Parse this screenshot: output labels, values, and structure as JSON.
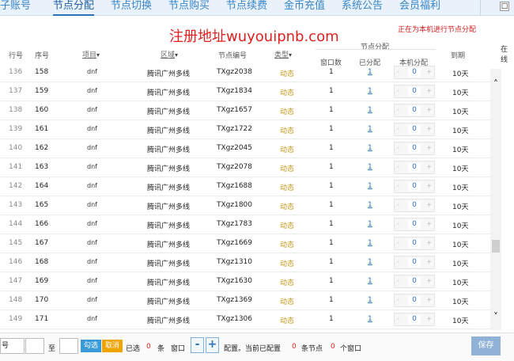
{
  "nav": {
    "tabs": [
      {
        "label": "子账号"
      },
      {
        "label": "节点分配"
      },
      {
        "label": "节点切换"
      },
      {
        "label": "节点购买"
      },
      {
        "label": "节点续费"
      },
      {
        "label": "金币充值"
      },
      {
        "label": "系统公告"
      },
      {
        "label": "会员福利"
      }
    ],
    "win_btn": "□"
  },
  "banner": {
    "watermark": "注册地址wuyouipnb.com",
    "status": "正在为本机进行节点分配",
    "right_cut": "在线"
  },
  "columns": {
    "rownum": "行号",
    "seq": "序号",
    "project": "项目",
    "area": "区域",
    "node_code": "节点编号",
    "type": "类型",
    "alloc_group": "节点分配",
    "win_count": "窗口数",
    "allocated": "已分配",
    "local_alloc": "本机分配",
    "expiry": "到期"
  },
  "rows": [
    {
      "rownum": "136",
      "seq": "158",
      "project": "dnf",
      "area": "腾讯广州多线",
      "code": "TXgz2038",
      "type": "动态",
      "win": "1",
      "alloc": "1",
      "local": "0",
      "exp": "10天"
    },
    {
      "rownum": "137",
      "seq": "159",
      "project": "dnf",
      "area": "腾讯广州多线",
      "code": "TXgz1834",
      "type": "动态",
      "win": "1",
      "alloc": "1",
      "local": "0",
      "exp": "10天"
    },
    {
      "rownum": "138",
      "seq": "160",
      "project": "dnf",
      "area": "腾讯广州多线",
      "code": "TXgz1657",
      "type": "动态",
      "win": "1",
      "alloc": "1",
      "local": "0",
      "exp": "10天"
    },
    {
      "rownum": "139",
      "seq": "161",
      "project": "dnf",
      "area": "腾讯广州多线",
      "code": "TXgz1722",
      "type": "动态",
      "win": "1",
      "alloc": "1",
      "local": "0",
      "exp": "10天"
    },
    {
      "rownum": "140",
      "seq": "162",
      "project": "dnf",
      "area": "腾讯广州多线",
      "code": "TXgz2045",
      "type": "动态",
      "win": "1",
      "alloc": "1",
      "local": "0",
      "exp": "10天"
    },
    {
      "rownum": "141",
      "seq": "163",
      "project": "dnf",
      "area": "腾讯广州多线",
      "code": "TXgz2078",
      "type": "动态",
      "win": "1",
      "alloc": "1",
      "local": "0",
      "exp": "10天"
    },
    {
      "rownum": "142",
      "seq": "164",
      "project": "dnf",
      "area": "腾讯广州多线",
      "code": "TXgz1688",
      "type": "动态",
      "win": "1",
      "alloc": "1",
      "local": "0",
      "exp": "10天"
    },
    {
      "rownum": "143",
      "seq": "165",
      "project": "dnf",
      "area": "腾讯广州多线",
      "code": "TXgz1800",
      "type": "动态",
      "win": "1",
      "alloc": "1",
      "local": "0",
      "exp": "10天"
    },
    {
      "rownum": "144",
      "seq": "166",
      "project": "dnf",
      "area": "腾讯广州多线",
      "code": "TXgz1783",
      "type": "动态",
      "win": "1",
      "alloc": "1",
      "local": "0",
      "exp": "10天"
    },
    {
      "rownum": "145",
      "seq": "167",
      "project": "dnf",
      "area": "腾讯广州多线",
      "code": "TXgz1669",
      "type": "动态",
      "win": "1",
      "alloc": "1",
      "local": "0",
      "exp": "10天"
    },
    {
      "rownum": "146",
      "seq": "168",
      "project": "dnf",
      "area": "腾讯广州多线",
      "code": "TXgz1310",
      "type": "动态",
      "win": "1",
      "alloc": "1",
      "local": "0",
      "exp": "10天"
    },
    {
      "rownum": "147",
      "seq": "169",
      "project": "dnf",
      "area": "腾讯广州多线",
      "code": "TXgz1630",
      "type": "动态",
      "win": "1",
      "alloc": "1",
      "local": "0",
      "exp": "10天"
    },
    {
      "rownum": "148",
      "seq": "170",
      "project": "dnf",
      "area": "腾讯广州多线",
      "code": "TXgz1369",
      "type": "动态",
      "win": "1",
      "alloc": "1",
      "local": "0",
      "exp": "10天"
    },
    {
      "rownum": "149",
      "seq": "171",
      "project": "dnf",
      "area": "腾讯广州多线",
      "code": "TXgz1306",
      "type": "动态",
      "win": "1",
      "alloc": "1",
      "local": "0",
      "exp": "10天"
    }
  ],
  "stepper_signs": {
    "minus": "-",
    "plus": "+"
  },
  "scroll": {
    "up": "˄",
    "down": "˅"
  },
  "footer": {
    "select_value": "号",
    "to": "至",
    "check_btn": "勾选",
    "invert_btn": "取消",
    "selected_prefix": "已选",
    "selected_count": "0",
    "unit_items": "条",
    "windows_label": "窗口",
    "minus": "-",
    "plus": "+",
    "configured_text": "配置。当前已配置",
    "configured_count": "0",
    "unit_nodes": "条节点",
    "window_count": "0",
    "unit_windows": "个窗口",
    "save_btn": "保存"
  }
}
